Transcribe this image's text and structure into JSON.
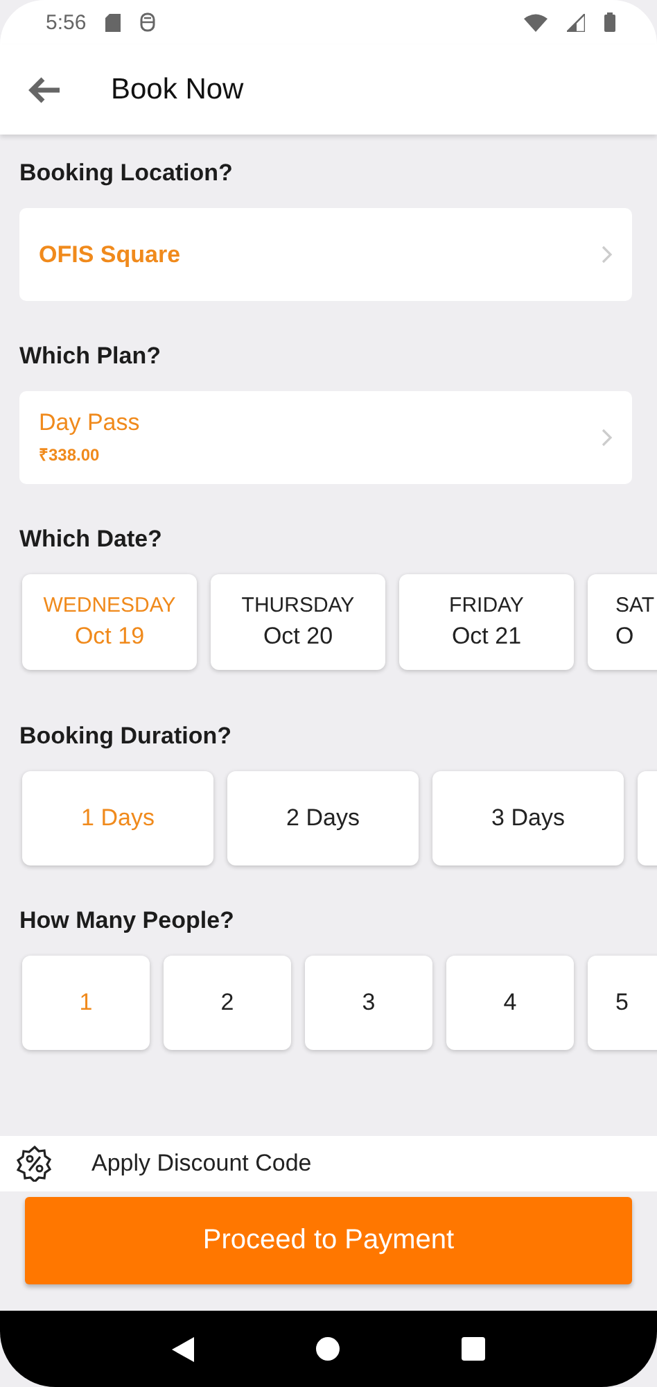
{
  "status_bar": {
    "time": "5:56"
  },
  "header": {
    "title": "Book Now"
  },
  "location": {
    "heading": "Booking Location?",
    "value": "OFIS Square"
  },
  "plan": {
    "heading": "Which Plan?",
    "name": "Day Pass",
    "price": "₹338.00"
  },
  "dates": {
    "heading": "Which Date?",
    "items": [
      {
        "kind": "full",
        "day": "WEDNESDAY",
        "date": "Oct 19",
        "selected": true
      },
      {
        "kind": "full",
        "day": "THURSDAY",
        "date": "Oct 20",
        "selected": false
      },
      {
        "kind": "full",
        "day": "FRIDAY",
        "date": "Oct 21",
        "selected": false
      },
      {
        "kind": "partial",
        "day": "SAT",
        "date": "O",
        "selected": false
      }
    ]
  },
  "duration": {
    "heading": "Booking Duration?",
    "items": [
      {
        "kind": "full",
        "label": "1 Days",
        "selected": true
      },
      {
        "kind": "full",
        "label": "2 Days",
        "selected": false
      },
      {
        "kind": "full",
        "label": "3 Days",
        "selected": false
      },
      {
        "kind": "partial"
      }
    ]
  },
  "people": {
    "heading": "How Many People?",
    "items": [
      {
        "kind": "full",
        "label": "1",
        "selected": true
      },
      {
        "kind": "full",
        "label": "2",
        "selected": false
      },
      {
        "kind": "full",
        "label": "3",
        "selected": false
      },
      {
        "kind": "full",
        "label": "4",
        "selected": false
      },
      {
        "kind": "partial",
        "label": "5",
        "selected": false
      }
    ]
  },
  "discount": {
    "label": "Apply Discount Code"
  },
  "proceed_button": {
    "label": "Proceed to Payment"
  }
}
